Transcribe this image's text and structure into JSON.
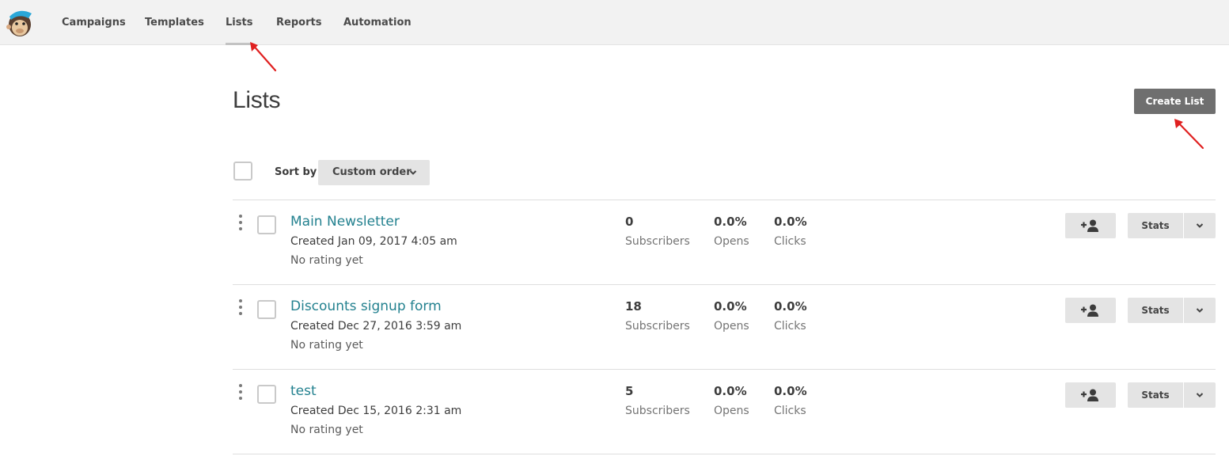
{
  "nav": {
    "items": [
      {
        "label": "Campaigns",
        "active": false
      },
      {
        "label": "Templates",
        "active": false
      },
      {
        "label": "Lists",
        "active": true
      },
      {
        "label": "Reports",
        "active": false
      },
      {
        "label": "Automation",
        "active": false
      }
    ]
  },
  "page": {
    "title": "Lists",
    "create_button": "Create List"
  },
  "toolbar": {
    "sort_label": "Sort by",
    "sort_value": "Custom order"
  },
  "stat_labels": {
    "subscribers": "Subscribers",
    "opens": "Opens",
    "clicks": "Clicks"
  },
  "actions": {
    "stats_label": "Stats"
  },
  "lists": [
    {
      "name": "Main Newsletter",
      "created": "Created Jan 09, 2017 4:05 am",
      "rating": "No rating yet",
      "subscribers": "0",
      "opens": "0.0%",
      "clicks": "0.0%"
    },
    {
      "name": "Discounts signup form",
      "created": "Created Dec 27, 2016 3:59 am",
      "rating": "No rating yet",
      "subscribers": "18",
      "opens": "0.0%",
      "clicks": "0.0%"
    },
    {
      "name": "test",
      "created": "Created Dec 15, 2016 2:31 am",
      "rating": "No rating yet",
      "subscribers": "5",
      "opens": "0.0%",
      "clicks": "0.0%"
    }
  ],
  "colors": {
    "link": "#23818f",
    "primary_button": "#6f6f6f",
    "annotation_arrow": "#e02020"
  }
}
